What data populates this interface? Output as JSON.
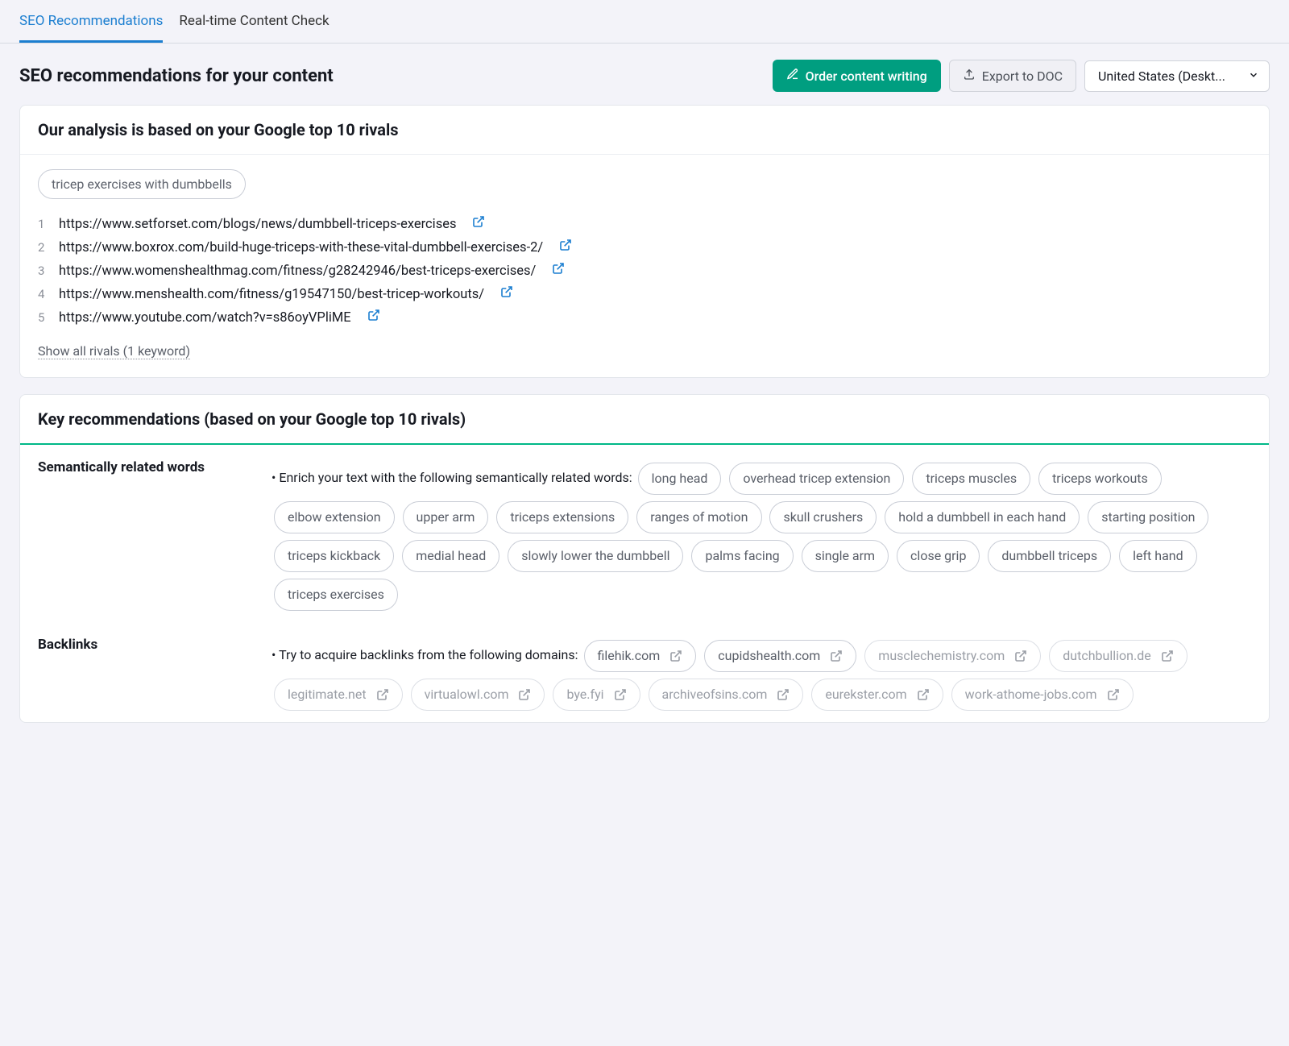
{
  "tabs": {
    "seo": "SEO Recommendations",
    "realtime": "Real-time Content Check"
  },
  "header": {
    "title": "SEO recommendations for your content",
    "order_btn": "Order content writing",
    "export_btn": "Export to DOC",
    "locale_select": "United States (Deskt..."
  },
  "analysis": {
    "title": "Our analysis is based on your Google top 10 rivals",
    "keyword": "tricep exercises with dumbbells",
    "rivals": [
      "https://www.setforset.com/blogs/news/dumbbell-triceps-exercises",
      "https://www.boxrox.com/build-huge-triceps-with-these-vital-dumbbell-exercises-2/",
      "https://www.womenshealthmag.com/fitness/g28242946/best-triceps-exercises/",
      "https://www.menshealth.com/fitness/g19547150/best-tricep-workouts/",
      "https://www.youtube.com/watch?v=s86oyVPliME"
    ],
    "show_all": "Show all rivals (1 keyword)"
  },
  "key_rec": {
    "title": "Key recommendations (based on your Google top 10 rivals)",
    "related_label": "Semantically related words",
    "related_lead": "Enrich your text with the following semantically related words:",
    "related_words": [
      "long head",
      "overhead tricep extension",
      "triceps muscles",
      "triceps workouts",
      "elbow extension",
      "upper arm",
      "triceps extensions",
      "ranges of motion",
      "skull crushers",
      "hold a dumbbell in each hand",
      "starting position",
      "triceps kickback",
      "medial head",
      "slowly lower the dumbbell",
      "palms facing",
      "single arm",
      "close grip",
      "dumbbell triceps",
      "left hand",
      "triceps exercises"
    ],
    "backlinks_label": "Backlinks",
    "backlinks_lead": "Try to acquire backlinks from the following domains:",
    "backlinks_active": [
      "filehik.com",
      "cupidshealth.com"
    ],
    "backlinks_dim": [
      "musclechemistry.com",
      "dutchbullion.de",
      "legitimate.net",
      "virtualowl.com",
      "bye.fyi",
      "archiveofsins.com",
      "eurekster.com",
      "work-athome-jobs.com"
    ]
  }
}
